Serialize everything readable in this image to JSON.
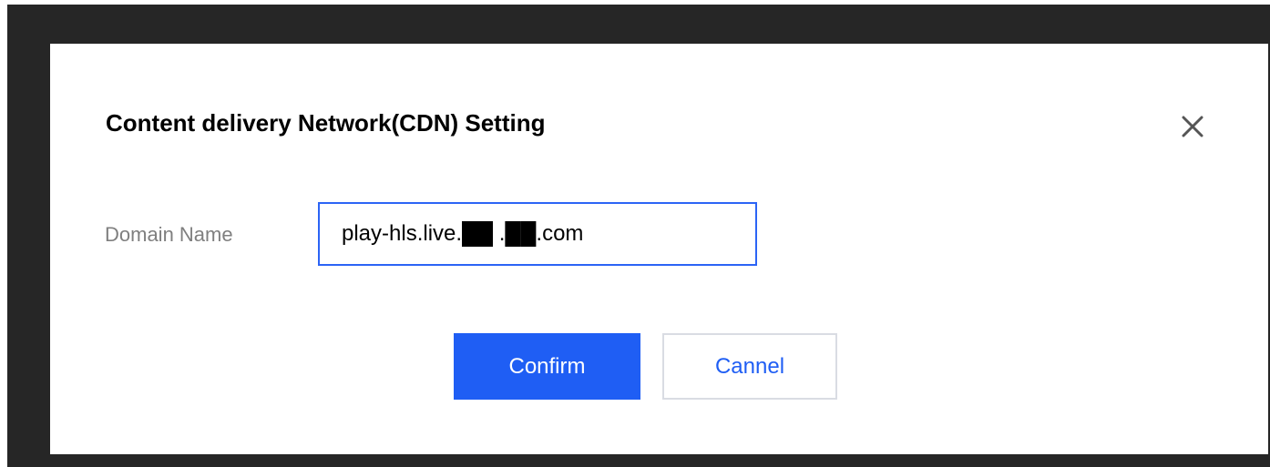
{
  "dialog": {
    "title": "Content delivery Network(CDN) Setting",
    "close_icon": "close-icon"
  },
  "form": {
    "domain_label": "Domain Name",
    "domain_value": "play-hls.live.██ .██.com"
  },
  "actions": {
    "confirm_label": "Confirm",
    "cancel_label": "Cannel"
  },
  "colors": {
    "accent": "#1f5ef4",
    "input_border": "#2c64f5",
    "label": "#7f7f7f",
    "backdrop": "#262626"
  }
}
